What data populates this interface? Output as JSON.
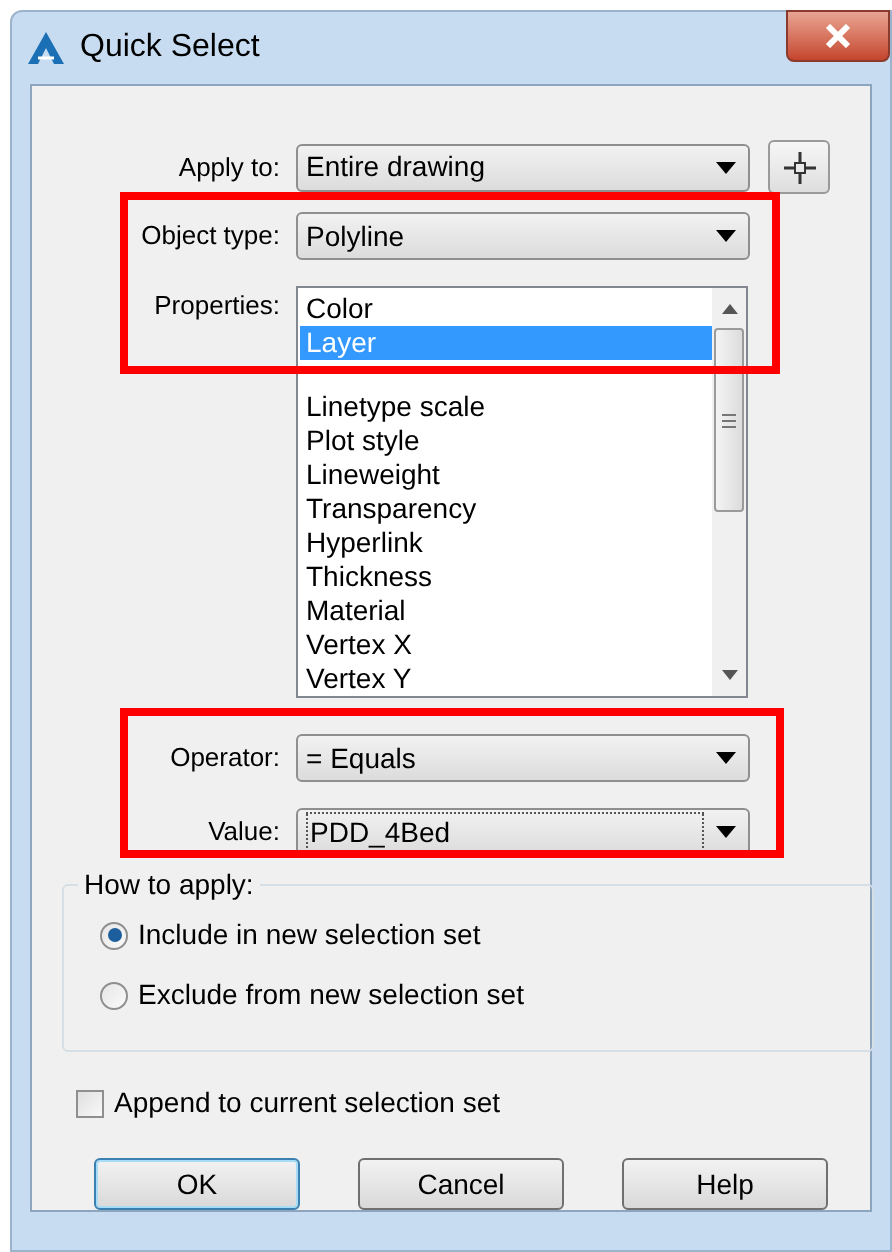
{
  "window": {
    "title": "Quick Select"
  },
  "apply_to": {
    "label": "Apply to:",
    "value": "Entire drawing"
  },
  "object_type": {
    "label": "Object type:",
    "value": "Polyline"
  },
  "properties": {
    "label": "Properties:",
    "items": [
      {
        "label": "Color",
        "selected": false
      },
      {
        "label": "Layer",
        "selected": true
      },
      {
        "label": "Linetype scale",
        "selected": false
      },
      {
        "label": "Plot style",
        "selected": false
      },
      {
        "label": "Lineweight",
        "selected": false
      },
      {
        "label": "Transparency",
        "selected": false
      },
      {
        "label": "Hyperlink",
        "selected": false
      },
      {
        "label": "Thickness",
        "selected": false
      },
      {
        "label": "Material",
        "selected": false
      },
      {
        "label": "Vertex X",
        "selected": false
      },
      {
        "label": "Vertex Y",
        "selected": false
      }
    ]
  },
  "operator": {
    "label": "Operator:",
    "value": "= Equals"
  },
  "value": {
    "label": "Value:",
    "value": "PDD_4Bed",
    "focused": true
  },
  "how_to_apply": {
    "title": "How to apply:",
    "options": [
      {
        "label": "Include in new selection set",
        "selected": true
      },
      {
        "label": "Exclude from new selection set",
        "selected": false
      }
    ]
  },
  "append": {
    "label": "Append to current selection set",
    "checked": false
  },
  "buttons": [
    {
      "label": "OK",
      "default": true
    },
    {
      "label": "Cancel",
      "default": false
    },
    {
      "label": "Help",
      "default": false
    }
  ]
}
